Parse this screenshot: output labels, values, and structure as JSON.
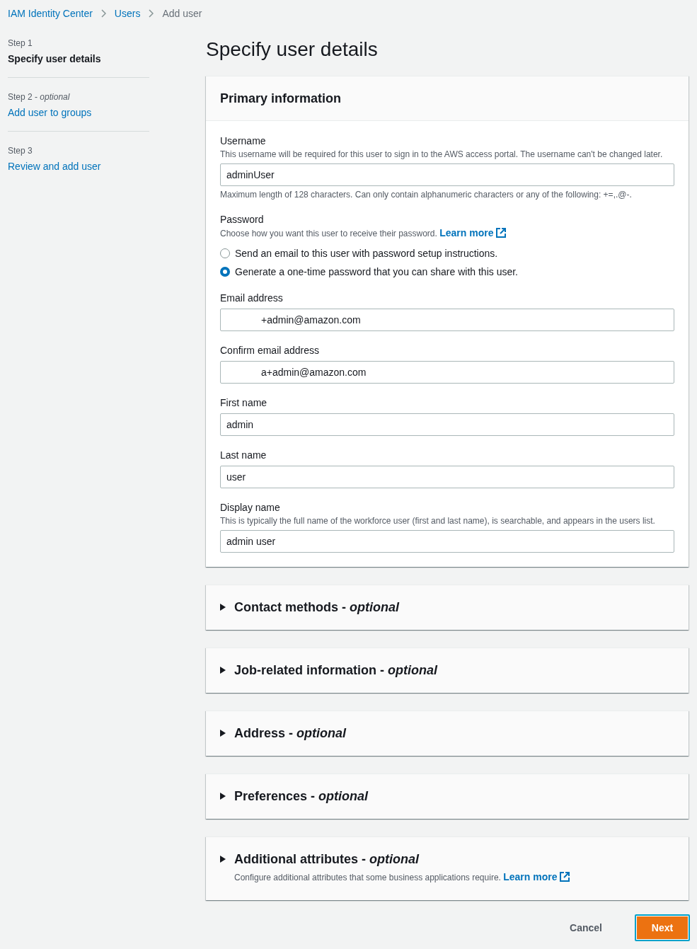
{
  "breadcrumbs": [
    {
      "label": "IAM Identity Center",
      "kind": "link"
    },
    {
      "label": "Users",
      "kind": "link"
    },
    {
      "label": "Add user",
      "kind": "current"
    }
  ],
  "steps": [
    {
      "step": "Step 1",
      "title": "Specify user details",
      "selected": true
    },
    {
      "step": "Step 2 - *optional*",
      "title": "Add user to groups",
      "selected": false
    },
    {
      "step": "Step 3",
      "title": "Review and add user",
      "selected": false
    }
  ],
  "page_title": "Specify user details",
  "primary_information": {
    "title": "Primary information",
    "fields": [
      {
        "kind": "text",
        "label": "Username",
        "description": "This username will be required for this user to sign in to the AWS access portal. The username can't be changed later.",
        "value": "adminUser",
        "constraint": "Maximum length of 128 characters. Can only contain alphanumeric characters or any of the following: +=,.@-."
      },
      {
        "kind": "radio",
        "label": "Password",
        "description": "Choose how you want this user to receive their password.",
        "link": "Learn more",
        "options": [
          {
            "label": "Send an email to this user with password setup instructions.",
            "selected": false
          },
          {
            "label": "Generate a one-time password that you can share with this user.",
            "selected": true
          }
        ]
      },
      {
        "kind": "text",
        "label": "Email address",
        "value": "+admin@amazon.com",
        "redacted": true
      },
      {
        "kind": "text",
        "label": "Confirm email address",
        "value": "a+admin@amazon.com",
        "redacted": true
      },
      {
        "kind": "text",
        "label": "First name",
        "value": "admin"
      },
      {
        "kind": "text",
        "label": "Last name",
        "value": "user"
      },
      {
        "kind": "text",
        "label": "Display name",
        "description": "This is typically the full name of the workforce user (first and last name), is searchable, and appears in the users list.",
        "value": "admin user"
      }
    ]
  },
  "sections": [
    {
      "title": "Contact methods - *optional*",
      "expanded": false
    },
    {
      "title": "Job-related information - *optional*",
      "expanded": false
    },
    {
      "title": "Address - *optional*",
      "expanded": false
    },
    {
      "title": "Preferences - *optional*",
      "expanded": false
    },
    {
      "title": "Additional attributes - *optional*",
      "expanded": false,
      "description": "Configure additional attributes that some business applications require.",
      "link": "Learn more"
    }
  ],
  "buttons": [
    {
      "label": "Cancel",
      "kind": "link"
    },
    {
      "label": "Next",
      "kind": "primary",
      "focused": true
    }
  ]
}
